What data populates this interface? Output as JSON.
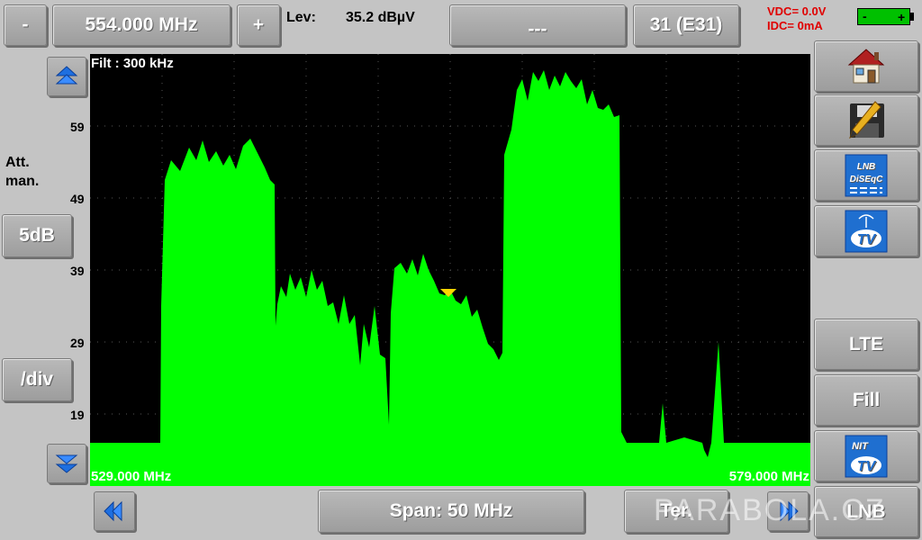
{
  "top": {
    "minus_label": "-",
    "frequency": "554.000 MHz",
    "plus_label": "+",
    "level_label": "Lev:",
    "level_value": "35.2 dBµV",
    "measure_value": "---",
    "channel": "31 (E31)",
    "vdc": "VDC= 0.0V",
    "idc": "IDC=  0mA"
  },
  "left": {
    "att_line1": "Att.",
    "att_line2": "man.",
    "att_value": "5dB",
    "div_label": "/div"
  },
  "spectrum": {
    "filter": "Filt : 300 kHz",
    "start_freq": "529.000 MHz",
    "end_freq": "579.000 MHz",
    "y_ticks": [
      "59",
      "49",
      "39",
      "29",
      "19"
    ],
    "trace_color": "#00ff00",
    "marker_color": "#ffd700"
  },
  "bottom": {
    "span": "Span: 50 MHz",
    "band": "Ter."
  },
  "right": {
    "lte_label": "LTE",
    "fill_label": "Fill",
    "lnb_label": "LNB",
    "diseqc_line1": "LNB",
    "diseqc_line2": "DiSEqC",
    "tv_label": "TV",
    "nit_label": "NIT"
  },
  "watermark": "PARABOLA.CZ",
  "colors": {
    "status_red": "#e00000",
    "battery_green": "#00c000"
  }
}
